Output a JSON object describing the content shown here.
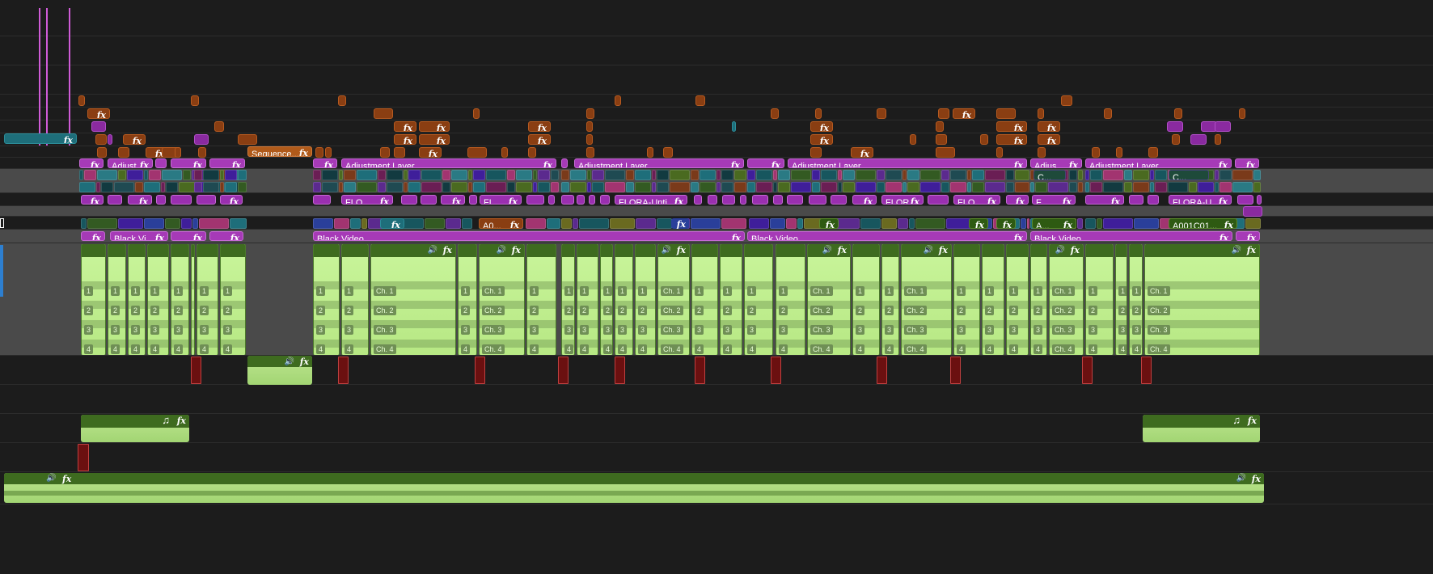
{
  "app": {
    "panel": "Sequence Timeline",
    "accent_colors": {
      "adjustment": "#a63ab7",
      "nested_sequence": "#b05a1a",
      "video_cyan": "#1e6e7a",
      "video_orange": "#8a3e12",
      "audio_green": "#b7e884",
      "audio_header": "#3e6b1f"
    }
  },
  "fx_badge": "fx",
  "speaker_icon": "speaker-icon",
  "music_icon": "♫",
  "video_tracks": {
    "sequence_clip": {
      "label": "Sequence..."
    },
    "adjustment_clips": [
      {
        "label": ""
      },
      {
        "label": "Adjust..."
      },
      {
        "label": ""
      },
      {
        "label": ""
      },
      {
        "label": "Adjustment Layer"
      },
      {
        "label": "Adjustment Layer"
      },
      {
        "label": ""
      },
      {
        "label": "Adjustment Layer"
      },
      {
        "label": "Adjus..."
      },
      {
        "label": ""
      },
      {
        "label": "Adjustment Layer"
      }
    ],
    "flora_clips": [
      {
        "label": "FLO..."
      },
      {
        "label": "FL..."
      },
      {
        "label": "FLORA-Unti..."
      },
      {
        "label": "FLOR..."
      },
      {
        "label": "FLO..."
      },
      {
        "label": "F..."
      },
      {
        "label": "FLORA-U..."
      }
    ],
    "c_clips": [
      {
        "label": "C..."
      },
      {
        "label": "C..."
      }
    ],
    "source_clips": [
      {
        "label": "A0..."
      },
      {
        "label": "A..."
      },
      {
        "label": "A001C01..."
      }
    ],
    "black_video_clips": [
      {
        "label": ""
      },
      {
        "label": "Black Vi..."
      },
      {
        "label": ""
      },
      {
        "label": ""
      },
      {
        "label": "Black Video"
      },
      {
        "label": "Black Video"
      },
      {
        "label": "Black Video"
      }
    ]
  },
  "audio_tracks": {
    "channel_labels_short": [
      "1",
      "2",
      "3",
      "4"
    ],
    "channel_labels": [
      "Ch. 1",
      "Ch. 2",
      "Ch. 3",
      "Ch. 4"
    ]
  }
}
